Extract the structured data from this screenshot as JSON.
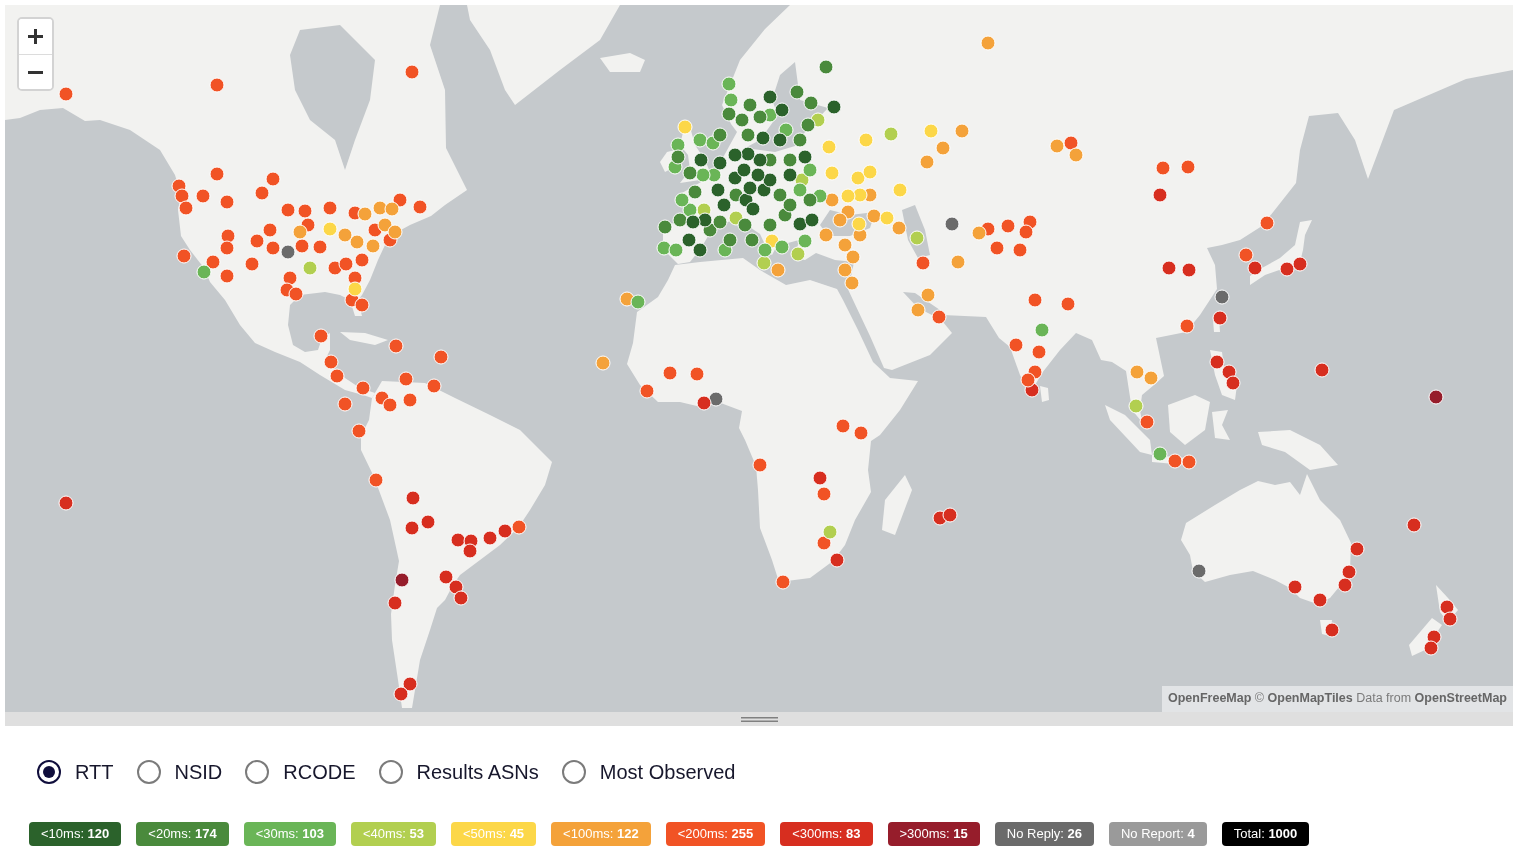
{
  "map": {
    "attribution": [
      {
        "kind": "link",
        "text": "OpenFreeMap"
      },
      {
        "kind": "text",
        "text": "©"
      },
      {
        "kind": "link",
        "text": "OpenMapTiles"
      },
      {
        "kind": "text",
        "text": "Data from"
      },
      {
        "kind": "link",
        "text": "OpenStreetMap"
      }
    ]
  },
  "modes": [
    {
      "label": "RTT",
      "selected": true
    },
    {
      "label": "NSID",
      "selected": false
    },
    {
      "label": "RCODE",
      "selected": false
    },
    {
      "label": "Results ASNs",
      "selected": false
    },
    {
      "label": "Most Observed",
      "selected": false
    }
  ],
  "legend": [
    {
      "text": "<10ms: **120**",
      "color": "#2b622b"
    },
    {
      "text": "<20ms: **174**",
      "color": "#4a8a3c"
    },
    {
      "text": "<30ms: **103**",
      "color": "#6ab557"
    },
    {
      "text": "<40ms: **53**",
      "color": "#b2cf50"
    },
    {
      "text": "<50ms: **45**",
      "color": "#fcd748"
    },
    {
      "text": "<100ms: **122**",
      "color": "#f4a23a"
    },
    {
      "text": "<200ms: **255**",
      "color": "#f15325"
    },
    {
      "text": "<300ms: **83**",
      "color": "#d72e1f"
    },
    {
      "text": ">300ms: **15**",
      "color": "#961d2b"
    },
    {
      "text": "No Reply: **26**",
      "color": "#6b6b6b"
    },
    {
      "text": "No Report: **4**",
      "color": "#9a9a9a"
    },
    {
      "text": "Total: **1000**",
      "color": "#000000"
    }
  ]
}
